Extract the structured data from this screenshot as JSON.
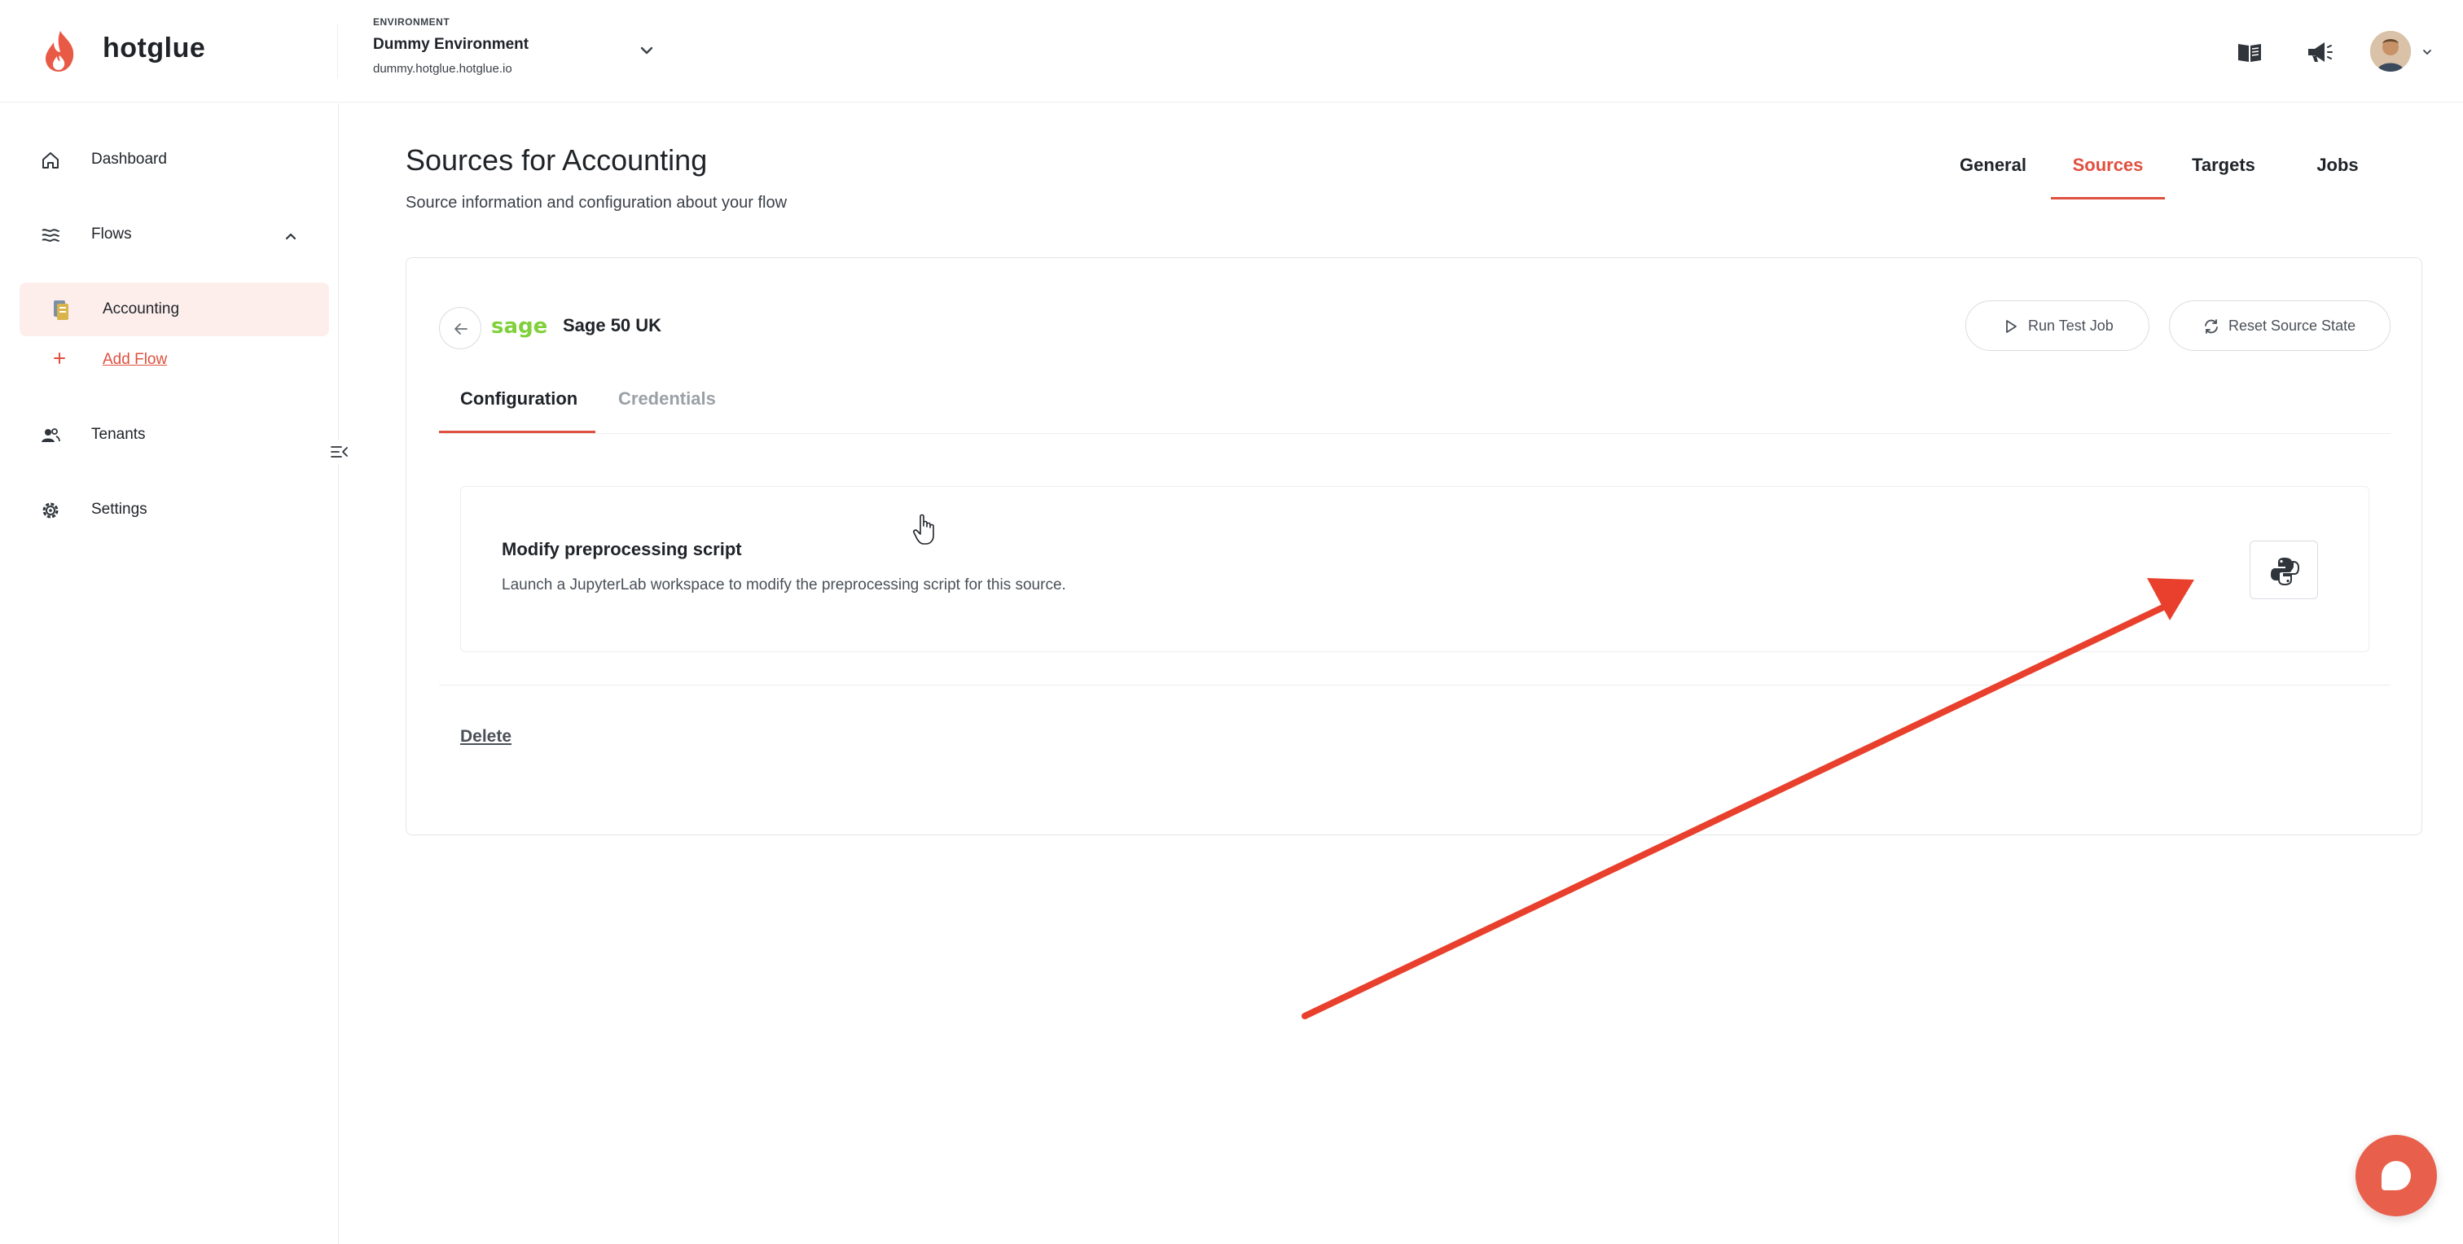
{
  "header": {
    "brand": "hotglue",
    "environment": {
      "caption": "ENVIRONMENT",
      "name": "Dummy Environment",
      "url": "dummy.hotglue.hotglue.io"
    }
  },
  "sidebar": {
    "items": [
      {
        "label": "Dashboard",
        "icon": "home-icon"
      },
      {
        "label": "Flows",
        "icon": "flows-icon"
      },
      {
        "label": "Accounting",
        "icon": "accounting-flow-icon"
      },
      {
        "label": "Add Flow",
        "icon": "plus-icon"
      },
      {
        "label": "Tenants",
        "icon": "users-icon"
      },
      {
        "label": "Settings",
        "icon": "gear-icon"
      }
    ]
  },
  "main": {
    "title": "Sources for Accounting",
    "subtitle": "Source information and configuration about your flow",
    "tabs": [
      {
        "label": "General"
      },
      {
        "label": "Sources",
        "active": true
      },
      {
        "label": "Targets"
      },
      {
        "label": "Jobs"
      }
    ]
  },
  "source": {
    "logo_text": "sage 50",
    "name": "Sage 50 UK",
    "run_test_label": "Run Test Job",
    "reset_label": "Reset Source State",
    "subtabs": [
      {
        "label": "Configuration",
        "active": true
      },
      {
        "label": "Credentials"
      }
    ],
    "script": {
      "title": "Modify preprocessing script",
      "description": "Launch a JupyterLab workspace to modify the preprocessing script for this source."
    },
    "delete_label": "Delete"
  },
  "colors": {
    "accent": "#e0503f",
    "active_bg": "#fdeeec",
    "annotation_arrow": "#e8402c",
    "sage_green": "#7fd03a"
  }
}
